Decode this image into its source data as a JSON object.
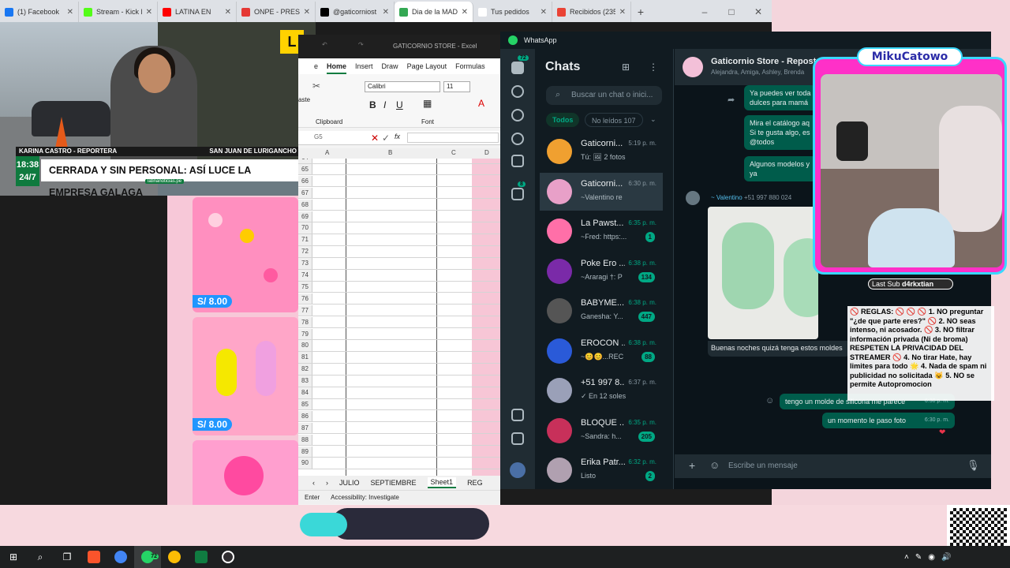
{
  "browser": {
    "tabs": [
      {
        "label": "(1) Facebook",
        "color": "#1877f2",
        "icon": "facebook-icon"
      },
      {
        "label": "Stream - Kick D",
        "color": "#53fc18",
        "icon": "kick-icon"
      },
      {
        "label": "LATINA EN",
        "color": "#ff0000",
        "icon": "youtube-icon"
      },
      {
        "label": "ONPE - PRESE",
        "color": "#e53935",
        "icon": "onpe-icon"
      },
      {
        "label": "@gaticorniost",
        "color": "#000000",
        "icon": "tiktok-icon"
      },
      {
        "label": "Dia de la MADR",
        "color": "#34a853",
        "icon": "drive-icon"
      },
      {
        "label": "Tus pedidos",
        "color": "#ffffff",
        "icon": "notion-icon"
      },
      {
        "label": "Recibidos (235",
        "color": "#ea4335",
        "icon": "gmail-icon"
      }
    ],
    "new_tab": "+",
    "window_controls": [
      "–",
      "□",
      "✕"
    ]
  },
  "news": {
    "reporter": "KARINA CASTRO - REPORTERA",
    "location": "SAN JUAN DE LURIGANCHO",
    "time": "18:38",
    "channel": "24/7",
    "headline": "CERRADA Y SIN PERSONAL: ASÍ LUCE LA EMPRESA GALAGA",
    "site": "latinanoticias.pe",
    "logo": "L"
  },
  "shop": {
    "prices": [
      "S/ 8.00",
      "S/ 8.00"
    ],
    "brand_color": "#ff8fbf"
  },
  "excel": {
    "doc_title": "GATICORNIO STORE - Excel",
    "menu": [
      "e",
      "Home",
      "Insert",
      "Draw",
      "Page Layout",
      "Formulas"
    ],
    "font_name": "Calibri",
    "font_size": "11",
    "clipboard_label": "Clipboard",
    "font_label": "Font",
    "paste_label": "aste",
    "cell_ref": "G5",
    "formula_fx": "fx",
    "columns": [
      "A",
      "B",
      "C",
      "D"
    ],
    "rows": [
      "64",
      "65",
      "66",
      "67",
      "68",
      "69",
      "70",
      "71",
      "72",
      "73",
      "74",
      "75",
      "76",
      "77",
      "78",
      "79",
      "80",
      "81",
      "82",
      "83",
      "84",
      "85",
      "86",
      "87",
      "88",
      "89",
      "90"
    ],
    "sheets": [
      "JULIO",
      "SEPTIEMBRE",
      "Sheet1",
      "REG"
    ],
    "status_mode": "Enter",
    "status_accessibility": "Accessibility: Investigate"
  },
  "whatsapp": {
    "app_title": "WhatsApp",
    "rail_badge_chats": "72",
    "rail_badge_status": "8",
    "chats_title": "Chats",
    "search_placeholder": "Buscar un chat o inici...",
    "filter_all": "Todos",
    "filter_unread": "No leídos 107",
    "chats": [
      {
        "name": "Gaticorni...",
        "time": "5:19 p. m.",
        "preview": "Tú: 🖼 2 fotos",
        "badge": "",
        "avatar": "#f0a030",
        "green": false
      },
      {
        "name": "Gaticorni...",
        "time": "6:30 p. m.",
        "preview": "~Valentino re",
        "badge": "",
        "avatar": "#e8a0c8",
        "green": false
      },
      {
        "name": "La Pawst...",
        "time": "6:35 p. m.",
        "preview": "~Fred: https:...",
        "badge": "1",
        "avatar": "#ff6fa8",
        "green": true
      },
      {
        "name": "Poke Ero ...",
        "time": "6:38 p. m.",
        "preview": "~Araragi †: P",
        "badge": "134",
        "avatar": "#7a2aa8",
        "green": true
      },
      {
        "name": "BABYME...",
        "time": "6:38 p. m.",
        "preview": "Ganesha: Y...",
        "badge": "447",
        "avatar": "#555555",
        "green": true
      },
      {
        "name": "EROCON ...",
        "time": "6:38 p. m.",
        "preview": "~😊😊...REC",
        "badge": "88",
        "avatar": "#2a5ad8",
        "green": true
      },
      {
        "name": "+51 997 8...",
        "time": "6:37 p. m.",
        "preview": "✓ En 12 soles",
        "badge": "",
        "avatar": "#9aa0b8",
        "green": false
      },
      {
        "name": "BLOQUE ...",
        "time": "6:35 p. m.",
        "preview": "~Sandra: h...",
        "badge": "205",
        "avatar": "#c8305a",
        "green": true
      },
      {
        "name": "Erika Patr...",
        "time": "6:32 p. m.",
        "preview": "Listo",
        "badge": "2",
        "avatar": "#b0a0b0",
        "green": true
      }
    ],
    "conversation": {
      "name": "Gaticornio Store - Reposterí",
      "members": "Alejandra, Amiga, Ashley, Brenda",
      "out1": "Ya puedes ver toda dulces para mamá",
      "out2": "Mira el catálogo aq Si te gusta algo, es @todos",
      "out3": "Algunos modelos y ya",
      "sender": "~ Valentino",
      "sender_phone": "+51 997 880 024",
      "in_caption": "Buenas noches quizá tenga estos moldes",
      "out4": "tengo un molde de silicona me parece",
      "out4_time": "6:30 p. m.",
      "out5": "un momento le paso foto",
      "out5_time": "6:30 p. m.",
      "compose_placeholder": "Escribe un mensaje"
    }
  },
  "overlay": {
    "streamer": "MikuCatowo",
    "last_sub_label": "Last Sub",
    "last_sub_name": "d4rkxtian",
    "rules": "🚫 REGLAS: 🚫 🚫 🚫 1. NO preguntar \"¿de que parte eres?\" 🚫 2. NO seas intenso, ni acosador. 🚫 3. NO filtrar información privada (Ni de broma) RESPETEN LA PRIVACIDAD DEL STREAMER 🚫 4. No tirar Hate, hay limites para todo 🌟 4. Nada de spam ni publicidad no solicitada 😺 5. NO se permite Autopromocion"
  },
  "taskbar": {
    "items": [
      "windows-icon",
      "search-icon",
      "taskview-icon",
      "brave-icon",
      "chrome-icon",
      "whatsapp-icon",
      "chrome-icon",
      "excel-icon",
      "obs-icon"
    ],
    "whatsapp_badge": "72"
  }
}
